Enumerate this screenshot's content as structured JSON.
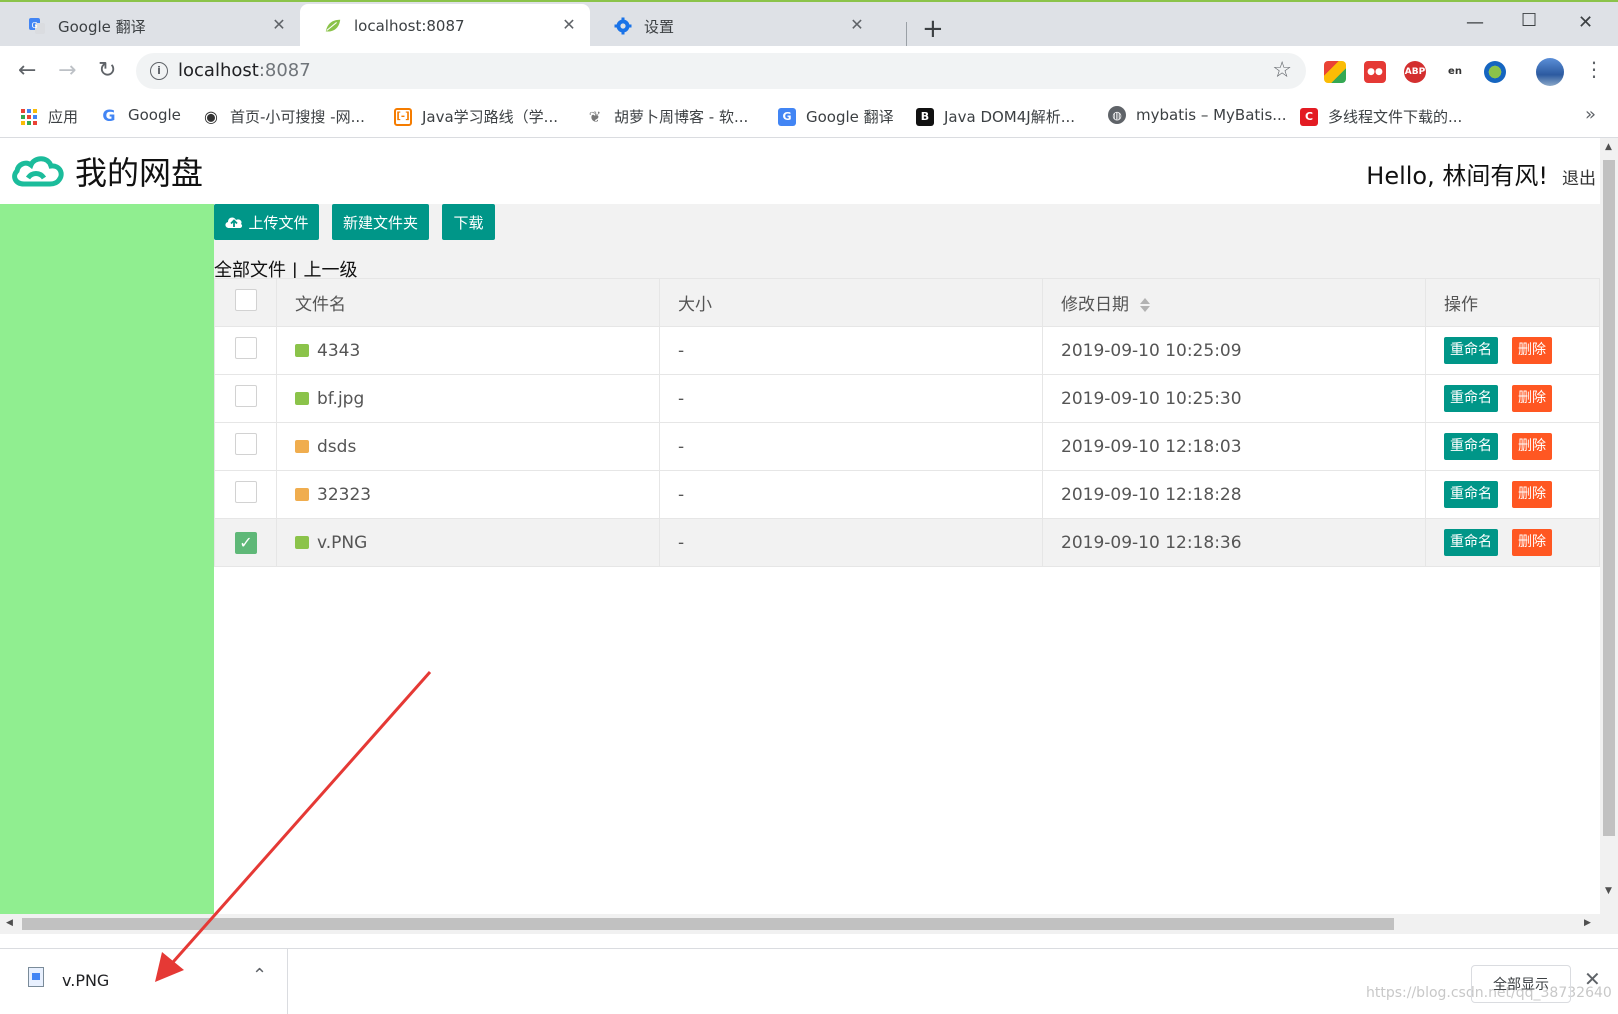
{
  "browser": {
    "tabs": [
      {
        "title": "Google 翻译",
        "favicon": "google-translate-icon"
      },
      {
        "title": "localhost:8087",
        "favicon": "spring-leaf-icon"
      },
      {
        "title": "设置",
        "favicon": "gear-icon"
      }
    ],
    "url_host": "localhost",
    "url_port": ":8087",
    "extensions": [
      "ABP",
      "en"
    ],
    "bookmarks": [
      "应用",
      "Google",
      "首页-小可搜搜 -网...",
      "Java学习路线（学...",
      "胡萝卜周博客 - 软...",
      "Google 翻译",
      "Java DOM4J解析...",
      "mybatis – MyBatis...",
      "多线程文件下载的..."
    ],
    "bookmark_badges": {
      "b": "B",
      "c": "C"
    }
  },
  "app": {
    "title": "我的网盘",
    "greeting": "Hello, 林间有风!",
    "logout": "退出",
    "buttons": {
      "upload": "上传文件",
      "new_folder": "新建文件夹",
      "download": "下载"
    },
    "breadcrumb": {
      "all": "全部文件",
      "sep": " | ",
      "up": "上一级"
    },
    "columns": {
      "name": "文件名",
      "size": "大小",
      "modified": "修改日期",
      "actions": "操作"
    },
    "action_labels": {
      "rename": "重命名",
      "delete": "删除"
    },
    "files": [
      {
        "name": "4343",
        "type": "image",
        "size": "-",
        "modified": "2019-09-10 10:25:09",
        "checked": false
      },
      {
        "name": "bf.jpg",
        "type": "image",
        "size": "-",
        "modified": "2019-09-10 10:25:30",
        "checked": false
      },
      {
        "name": "dsds",
        "type": "folder",
        "size": "-",
        "modified": "2019-09-10 12:18:03",
        "checked": false
      },
      {
        "name": "32323",
        "type": "folder",
        "size": "-",
        "modified": "2019-09-10 12:18:28",
        "checked": false
      },
      {
        "name": "v.PNG",
        "type": "image",
        "size": "-",
        "modified": "2019-09-10 12:18:36",
        "checked": true
      }
    ]
  },
  "download_shelf": {
    "file": "v.PNG",
    "show_all": "全部显示",
    "watermark": "https://blog.csdn.net/qq_38732640"
  },
  "colors": {
    "accent": "#009688",
    "danger": "#ff5722",
    "sidebar": "#90ee90",
    "annotation_arrow": "#e53935"
  }
}
